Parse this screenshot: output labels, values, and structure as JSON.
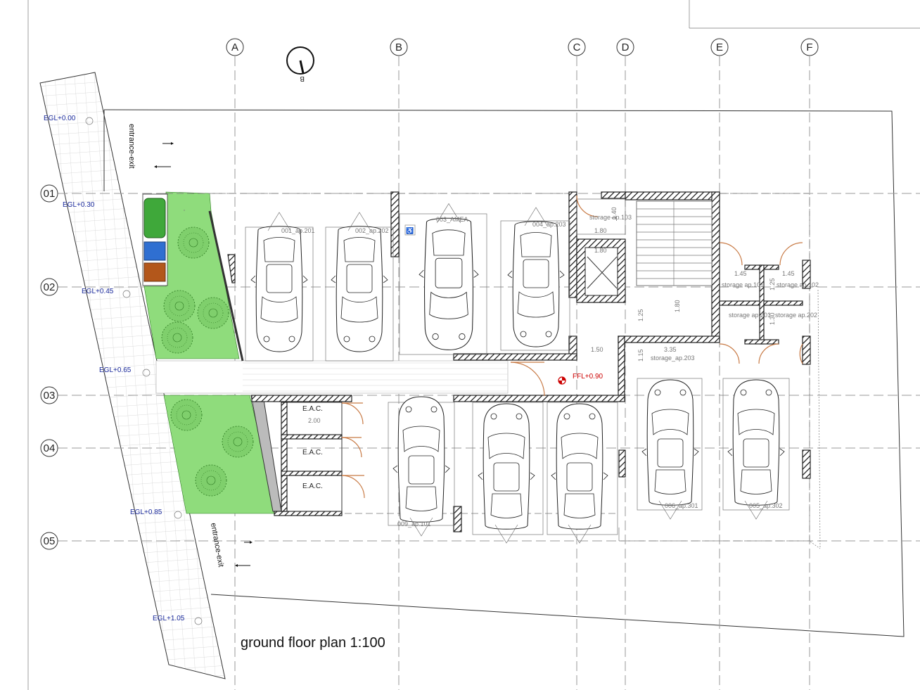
{
  "title": "ground floor plan  1:100",
  "axes_columns": [
    "A",
    "B",
    "C",
    "D",
    "E",
    "F"
  ],
  "axes_rows": [
    "01",
    "02",
    "03",
    "04",
    "05"
  ],
  "section_marker": "B",
  "levels": {
    "egl_000": "EGL+0.00",
    "egl_030": "EGL+0.30",
    "egl_045": "EGL+0.45",
    "egl_065": "EGL+0.65",
    "egl_085": "EGL+0.85",
    "egl_105": "EGL+1.05",
    "ffl": "FFL+0.90"
  },
  "entrances": {
    "top": "entrance-exit",
    "bottom": "entrance-exit"
  },
  "parking": {
    "p1": "001_ap.201",
    "p2": "002_ap.202",
    "p3": "003_AMEA",
    "p4": "004_ap.203",
    "p5": "005_ap.302",
    "p6": "006_ap.301",
    "p9": "009_ap.101"
  },
  "eac": [
    "E.A.C.",
    "E.A.C.",
    "E.A.C."
  ],
  "storage": {
    "s103": "storage ap.103",
    "s101": "storage ap.101",
    "s102": "storage ap.102",
    "s201": "storage ap.201",
    "s202": "storage ap.202",
    "s203": "storage_ap.203"
  },
  "dims": {
    "d180a": "1.80",
    "d180b": "1.80",
    "d140": "1.40",
    "d145a": "1.45",
    "d145b": "1.45",
    "d150": "1.50",
    "d335": "3.35",
    "d200": "2.00",
    "d180c": "1.80",
    "d125a": "1.25",
    "d115": "1.15",
    "d130": "1.30",
    "d125b": "1.25"
  },
  "colors": {
    "green": "#8fdc7c",
    "bin_green": "#3fa83a",
    "bin_blue": "#2f6fd1",
    "bin_brown": "#b3571b",
    "door": "#c87a45"
  }
}
